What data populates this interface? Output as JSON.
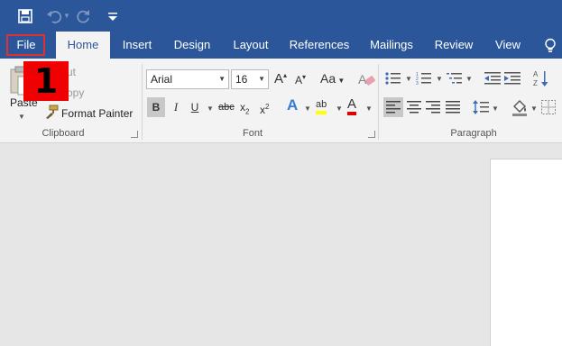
{
  "qat": {
    "save_icon": "save-icon",
    "undo_icon": "undo-icon",
    "redo_icon": "redo-icon",
    "customize_icon": "customize-qat-icon"
  },
  "tabs": [
    {
      "label": "File"
    },
    {
      "label": "Home"
    },
    {
      "label": "Insert"
    },
    {
      "label": "Design"
    },
    {
      "label": "Layout"
    },
    {
      "label": "References"
    },
    {
      "label": "Mailings"
    },
    {
      "label": "Review"
    },
    {
      "label": "View"
    }
  ],
  "tell_me_icon": "lightbulb-icon",
  "clipboard": {
    "paste_label": "Paste",
    "cut_label": "ut",
    "copy_label": "opy",
    "format_painter_label": "Format Painter",
    "group_label": "Clipboard"
  },
  "font": {
    "font_name": "Arial",
    "font_size": "16",
    "grow_label": "A",
    "shrink_label": "A",
    "change_case_label": "Aa",
    "bold": "B",
    "italic": "I",
    "underline": "U",
    "strike": "abc",
    "subscript": "x",
    "superscript": "x",
    "sub_digit": "2",
    "sup_digit": "2",
    "effects_label": "A",
    "highlight_label": "ab",
    "font_color_label": "A",
    "group_label": "Font"
  },
  "paragraph": {
    "group_label": "Paragraph"
  },
  "step_badge": "1",
  "colors": {
    "title_bar": "#2b579a",
    "highlight": "#ffff00",
    "font_color": "#e00000",
    "badge": "#f00000"
  }
}
